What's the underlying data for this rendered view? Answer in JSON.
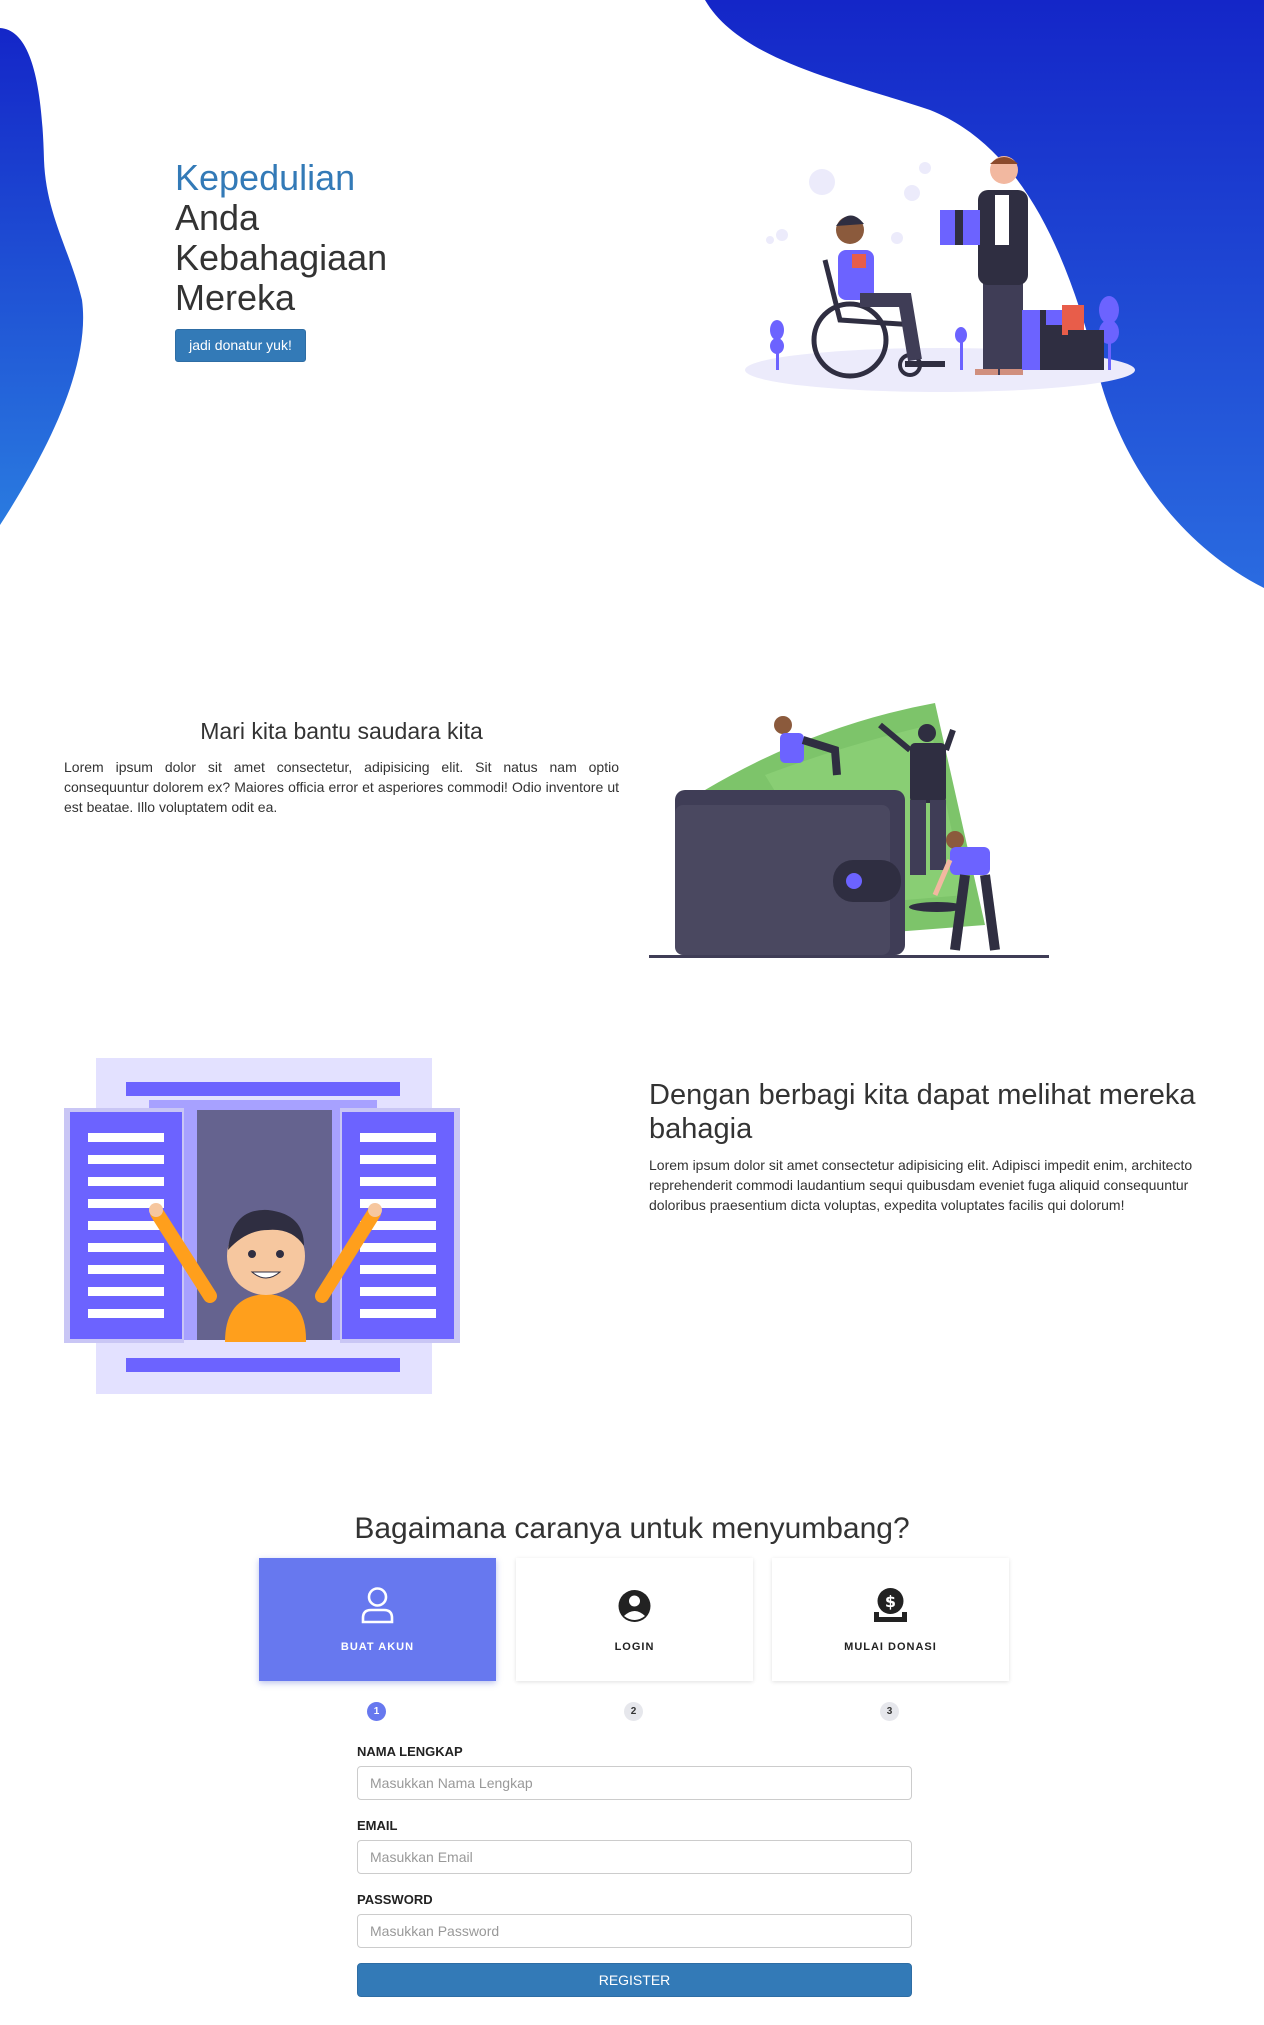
{
  "hero": {
    "title_accent": "Kepedulian",
    "title_line1": "Anda",
    "title_line2": "Kebahagiaan",
    "title_line3": "Mereka",
    "cta_label": "jadi donatur yuk!"
  },
  "section_help": {
    "title": "Mari kita bantu saudara kita",
    "text": "Lorem ipsum dolor sit amet consectetur, adipisicing elit. Sit natus nam optio consequuntur dolorem ex? Maiores officia error et asperiores commodi! Odio inventore ut est beatae. Illo voluptatem odit ea."
  },
  "section_share": {
    "title": "Dengan berbagi kita dapat melihat mereka bahagia",
    "text": "Lorem ipsum dolor sit amet consectetur adipisicing elit. Adipisci impedit enim, architecto reprehenderit commodi laudantium sequi quibusdam eveniet fuga aliquid consequuntur doloribus praesentium dicta voluptas, expedita voluptates facilis qui dolorum!"
  },
  "how_to": {
    "title": "Bagaimana caranya untuk menyumbang?",
    "steps": [
      {
        "label": "BUAT AKUN",
        "number": "1",
        "icon": "user-outline-icon",
        "active": true
      },
      {
        "label": "LOGIN",
        "number": "2",
        "icon": "user-circle-icon",
        "active": false
      },
      {
        "label": "MULAI DONASI",
        "number": "3",
        "icon": "donate-icon",
        "active": false
      }
    ]
  },
  "form": {
    "name_label": "NAMA LENGKAP",
    "name_placeholder": "Masukkan Nama Lengkap",
    "email_label": "EMAIL",
    "email_placeholder": "Masukkan Email",
    "password_label": "PASSWORD",
    "password_placeholder": "Masukkan Password",
    "submit_label": "REGISTER"
  },
  "colors": {
    "primary": "#337ab7",
    "step_active": "#6778ef",
    "blob_dark": "#1426c8",
    "blob_light": "#2a7be0",
    "illustration_purple": "#6c63ff"
  }
}
